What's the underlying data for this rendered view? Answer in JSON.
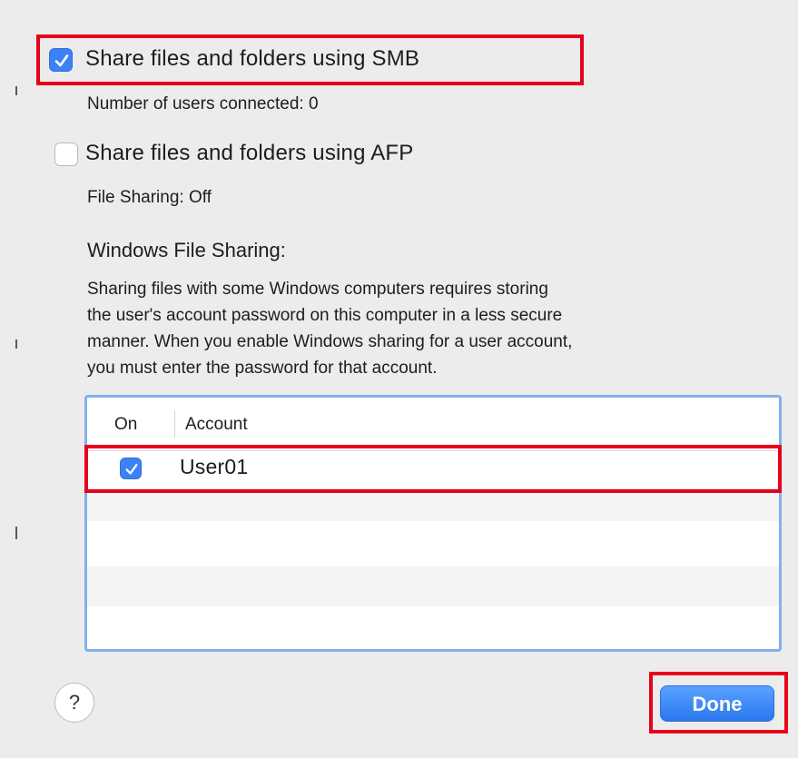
{
  "smb": {
    "label": "Share files and folders using SMB",
    "checked": true,
    "status": "Number of users connected: 0"
  },
  "afp": {
    "label": "Share files and folders using AFP",
    "checked": false,
    "status": "File Sharing: Off"
  },
  "windows_sharing": {
    "heading": "Windows File Sharing:",
    "description_lines": [
      "Sharing files with some Windows computers requires storing",
      "the user's account password on this computer in a less secure",
      "manner.  When you enable Windows sharing for a user account,",
      "you must enter the password for that account."
    ]
  },
  "accounts_table": {
    "columns": [
      "On",
      "Account"
    ],
    "rows": [
      {
        "on": true,
        "account": "User01"
      }
    ]
  },
  "footer": {
    "help_label": "?",
    "done_label": "Done"
  },
  "colors": {
    "accent": "#3b82f6",
    "highlight_box": "#e8001a",
    "table_border": "#7fb1ef"
  },
  "icons": {
    "checkmark": "checkmark-icon",
    "help": "question-mark-icon"
  }
}
